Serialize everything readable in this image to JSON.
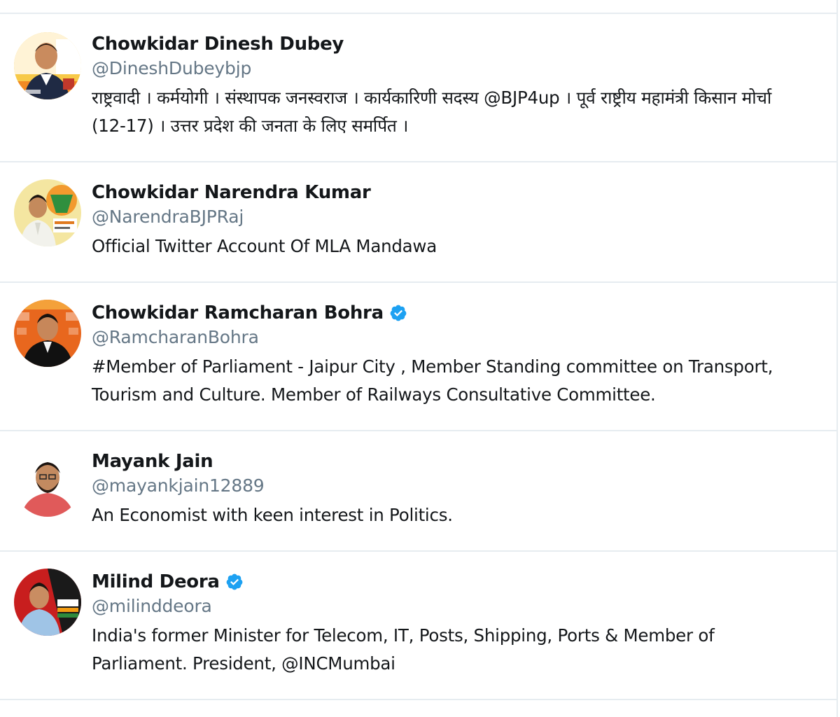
{
  "users": [
    {
      "display_name": "Chowkidar Dinesh Dubey",
      "handle": "@DineshDubeybjp",
      "verified": false,
      "bio": "राष्ट्रवादी । कर्मयोगी । संस्थापक जनस्वराज । कार्यकारिणी सदस्य @BJP4up । पूर्व राष्ट्रीय महामंत्री किसान मोर्चा (12-17) । उत्तर प्रदेश की जनता के लिए समर्पित ।"
    },
    {
      "display_name": "Chowkidar Narendra Kumar",
      "handle": "@NarendraBJPRaj",
      "verified": false,
      "bio": "Official Twitter Account Of MLA Mandawa"
    },
    {
      "display_name": "Chowkidar Ramcharan Bohra",
      "handle": "@RamcharanBohra",
      "verified": true,
      "bio": "#Member of Parliament - Jaipur City , Member Standing committee on Transport, Tourism and Culture. Member of Railways Consultative Committee."
    },
    {
      "display_name": "Mayank Jain",
      "handle": "@mayankjain12889",
      "verified": false,
      "bio": "An Economist with keen interest in Politics."
    },
    {
      "display_name": "Milind Deora",
      "handle": "@milinddeora",
      "verified": true,
      "bio": "India's former Minister for Telecom, IT, Posts, Shipping, Ports & Member of Parliament. President, @INCMumbai"
    }
  ],
  "colors": {
    "verified_badge": "#1da1f2",
    "handle_text": "#657786",
    "divider": "#e6ecf0"
  },
  "icons": {
    "verified": "verified-badge-icon"
  }
}
